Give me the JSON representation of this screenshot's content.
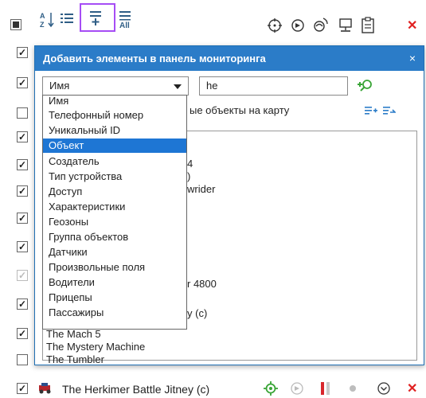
{
  "toolbar": {
    "icons": [
      "checkbox-partial",
      "sort-alpha-icon",
      "list-icon",
      "add-to-list-icon",
      "add-all-icon",
      "locate-icon",
      "arrow-circle-icon",
      "route-icon",
      "monitor-icon",
      "clipboard-icon",
      "close-icon"
    ],
    "all_label": "All"
  },
  "left_checkboxes": [
    "checked",
    "checked",
    "unchecked",
    "checked",
    "checked",
    "checked",
    "checked",
    "checked",
    "checked-dim",
    "checked",
    "checked",
    "unchecked"
  ],
  "dialog": {
    "title": "Добавить элементы в панель мониторинга",
    "close": "×",
    "filter_select": "Имя",
    "search_value": "he",
    "subrow_text": "ые объекты на карту",
    "dropdown_options": [
      "Имя",
      "Телефонный номер",
      "Уникальный ID",
      "Объект",
      "Создатель",
      "Тип устройства",
      "Доступ",
      "Характеристики",
      "Геозоны",
      "Группа объектов",
      "Датчики",
      "Произвольные поля",
      "Водители",
      "Прицепы",
      "Пассажиры"
    ],
    "selected_option": "Объект",
    "list_partial": [
      "4",
      ")",
      "wrider",
      "r 4800",
      "y (c)"
    ],
    "list_visible": [
      "The Mach 5",
      "The Mystery Machine",
      "The Tumbler"
    ]
  },
  "bottom_row": {
    "label": "The Herkimer Battle Jitney (c)"
  },
  "colors": {
    "header_blue": "#2b7cc8",
    "highlight_purple": "#a64df5",
    "selected_blue": "#1e76d4",
    "accent_green": "#3aa537",
    "close_red": "#e02020"
  }
}
